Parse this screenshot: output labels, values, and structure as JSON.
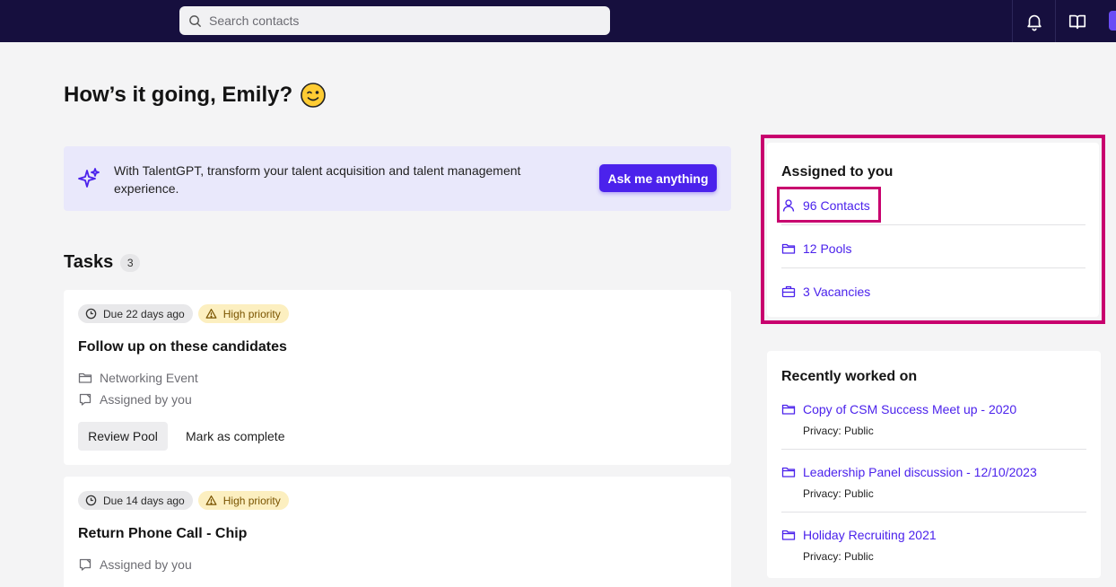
{
  "topbar": {
    "search_placeholder": "Search contacts",
    "icons": [
      "search-icon",
      "bell-icon",
      "book-icon"
    ]
  },
  "greeting": {
    "text": "How’s it going, Emily?",
    "emoji": "winking-face"
  },
  "banner": {
    "text": "With TalentGPT, transform your talent acquisition and talent management experience.",
    "button_label": "Ask me anything",
    "accent": "#4b22ec",
    "background": "#e9e8fb"
  },
  "tasks": {
    "title": "Tasks",
    "count": "3",
    "items": [
      {
        "due": "Due 22 days ago",
        "priority": "High priority",
        "title": "Follow up on these candidates",
        "pool": "Networking Event",
        "assigned": "Assigned by you",
        "primary_action": "Review Pool",
        "secondary_action": "Mark as complete"
      },
      {
        "due": "Due 14 days ago",
        "priority": "High priority",
        "title": "Return Phone Call - Chip",
        "assigned": "Assigned by you"
      }
    ]
  },
  "assigned": {
    "title": "Assigned to you",
    "contacts": "96 Contacts",
    "pools": "12 Pools",
    "vacancies": "3 Vacancies",
    "highlight_color": "#c8006e"
  },
  "recent": {
    "title": "Recently worked on",
    "privacy_label": "Privacy:",
    "items": [
      {
        "name": "Copy of CSM Success Meet up - 2020",
        "privacy": "Public"
      },
      {
        "name": "Leadership Panel discussion - 12/10/2023",
        "privacy": "Public"
      },
      {
        "name": "Holiday Recruiting 2021",
        "privacy": "Public"
      }
    ]
  }
}
